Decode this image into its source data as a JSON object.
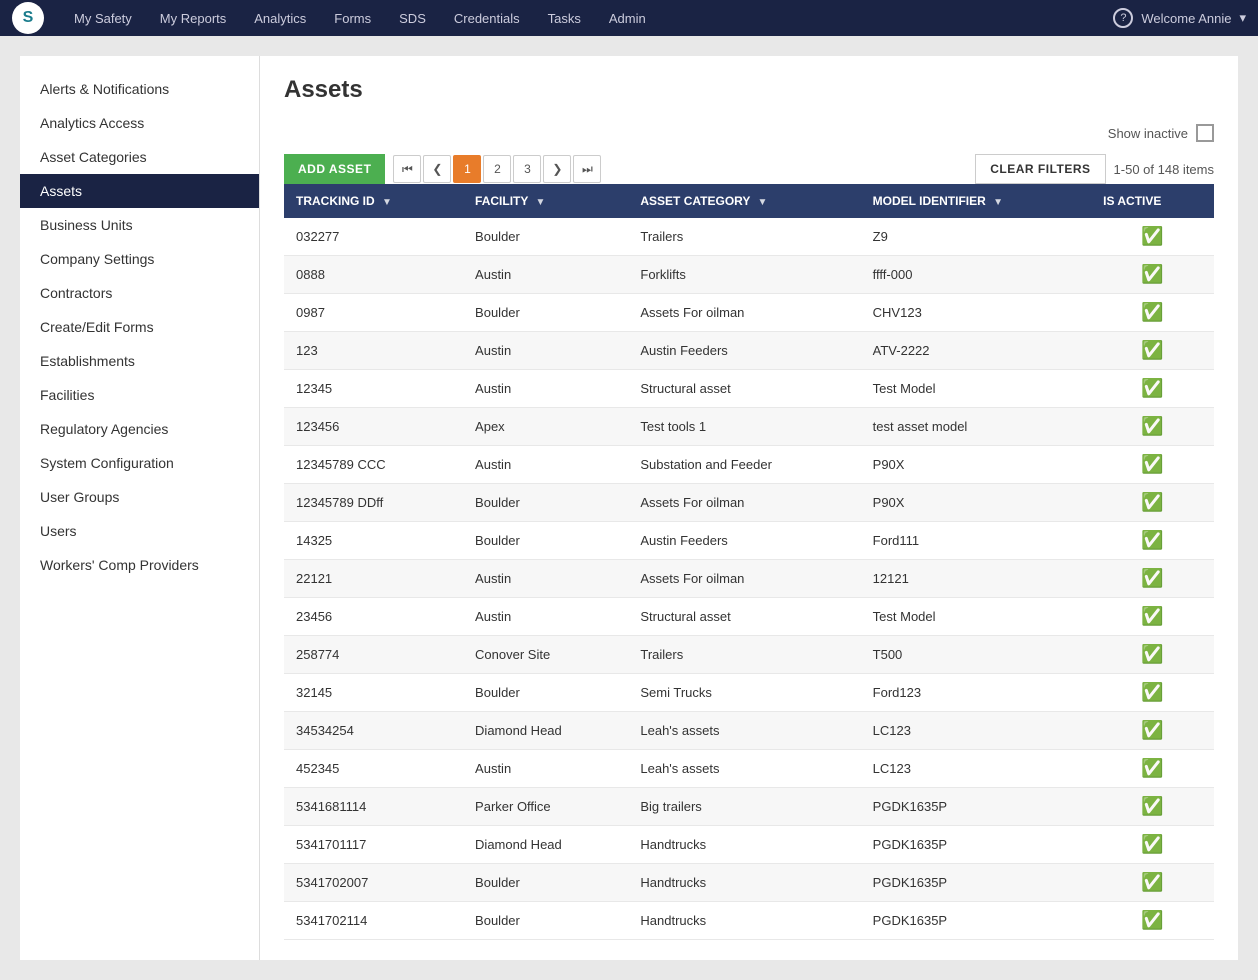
{
  "topNav": {
    "logo": "S",
    "links": [
      {
        "label": "My Safety",
        "name": "my-safety"
      },
      {
        "label": "My Reports",
        "name": "my-reports"
      },
      {
        "label": "Analytics",
        "name": "analytics"
      },
      {
        "label": "Forms",
        "name": "forms"
      },
      {
        "label": "SDS",
        "name": "sds"
      },
      {
        "label": "Credentials",
        "name": "credentials"
      },
      {
        "label": "Tasks",
        "name": "tasks"
      },
      {
        "label": "Admin",
        "name": "admin"
      }
    ],
    "welcome": "Welcome Annie",
    "help_icon": "?"
  },
  "sidebar": {
    "items": [
      {
        "label": "Alerts & Notifications",
        "name": "alerts-notifications",
        "active": false
      },
      {
        "label": "Analytics Access",
        "name": "analytics-access",
        "active": false
      },
      {
        "label": "Asset Categories",
        "name": "asset-categories",
        "active": false
      },
      {
        "label": "Assets",
        "name": "assets",
        "active": true
      },
      {
        "label": "Business Units",
        "name": "business-units",
        "active": false
      },
      {
        "label": "Company Settings",
        "name": "company-settings",
        "active": false
      },
      {
        "label": "Contractors",
        "name": "contractors",
        "active": false
      },
      {
        "label": "Create/Edit Forms",
        "name": "create-edit-forms",
        "active": false
      },
      {
        "label": "Establishments",
        "name": "establishments",
        "active": false
      },
      {
        "label": "Facilities",
        "name": "facilities",
        "active": false
      },
      {
        "label": "Regulatory Agencies",
        "name": "regulatory-agencies",
        "active": false
      },
      {
        "label": "System Configuration",
        "name": "system-configuration",
        "active": false
      },
      {
        "label": "User Groups",
        "name": "user-groups",
        "active": false
      },
      {
        "label": "Users",
        "name": "users",
        "active": false
      },
      {
        "label": "Workers' Comp Providers",
        "name": "workers-comp-providers",
        "active": false
      }
    ]
  },
  "content": {
    "page_title": "Assets",
    "show_inactive_label": "Show inactive",
    "add_asset_label": "ADD ASSET",
    "clear_filters_label": "CLEAR FILTERS",
    "items_count": "1-50 of 148 items",
    "pagination": {
      "pages": [
        "1",
        "2",
        "3"
      ],
      "active_page": "1"
    },
    "table": {
      "columns": [
        {
          "label": "TRACKING ID",
          "name": "tracking-id-col"
        },
        {
          "label": "FACILITY",
          "name": "facility-col"
        },
        {
          "label": "ASSET CATEGORY",
          "name": "asset-category-col"
        },
        {
          "label": "MODEL IDENTIFIER",
          "name": "model-identifier-col"
        },
        {
          "label": "IS ACTIVE",
          "name": "is-active-col"
        }
      ],
      "rows": [
        {
          "tracking_id": "032277",
          "facility": "Boulder",
          "asset_category": "Trailers",
          "model_identifier": "Z9",
          "is_active": true
        },
        {
          "tracking_id": "0888",
          "facility": "Austin",
          "asset_category": "Forklifts",
          "model_identifier": "ffff-000",
          "is_active": true
        },
        {
          "tracking_id": "0987",
          "facility": "Boulder",
          "asset_category": "Assets For oilman",
          "model_identifier": "CHV123",
          "is_active": true
        },
        {
          "tracking_id": "123",
          "facility": "Austin",
          "asset_category": "Austin Feeders",
          "model_identifier": "ATV-2222",
          "is_active": true
        },
        {
          "tracking_id": "12345",
          "facility": "Austin",
          "asset_category": "Structural asset",
          "model_identifier": "Test Model",
          "is_active": true
        },
        {
          "tracking_id": "123456",
          "facility": "Apex",
          "asset_category": "Test tools 1",
          "model_identifier": "test asset model",
          "is_active": true
        },
        {
          "tracking_id": "12345789 CCC",
          "facility": "Austin",
          "asset_category": "Substation and Feeder",
          "model_identifier": "P90X",
          "is_active": true
        },
        {
          "tracking_id": "12345789 DDff",
          "facility": "Boulder",
          "asset_category": "Assets For oilman",
          "model_identifier": "P90X",
          "is_active": true
        },
        {
          "tracking_id": "14325",
          "facility": "Boulder",
          "asset_category": "Austin Feeders",
          "model_identifier": "Ford111",
          "is_active": true
        },
        {
          "tracking_id": "22121",
          "facility": "Austin",
          "asset_category": "Assets For oilman",
          "model_identifier": "12121",
          "is_active": true
        },
        {
          "tracking_id": "23456",
          "facility": "Austin",
          "asset_category": "Structural asset",
          "model_identifier": "Test Model",
          "is_active": true
        },
        {
          "tracking_id": "258774",
          "facility": "Conover Site",
          "asset_category": "Trailers",
          "model_identifier": "T500",
          "is_active": true
        },
        {
          "tracking_id": "32145",
          "facility": "Boulder",
          "asset_category": "Semi Trucks",
          "model_identifier": "Ford123",
          "is_active": true
        },
        {
          "tracking_id": "34534254",
          "facility": "Diamond Head",
          "asset_category": "Leah's assets",
          "model_identifier": "LC123",
          "is_active": true
        },
        {
          "tracking_id": "452345",
          "facility": "Austin",
          "asset_category": "Leah's assets",
          "model_identifier": "LC123",
          "is_active": true
        },
        {
          "tracking_id": "5341681114",
          "facility": "Parker Office",
          "asset_category": "Big trailers",
          "model_identifier": "PGDK1635P",
          "is_active": true
        },
        {
          "tracking_id": "5341701117",
          "facility": "Diamond Head",
          "asset_category": "Handtrucks",
          "model_identifier": "PGDK1635P",
          "is_active": true
        },
        {
          "tracking_id": "5341702007",
          "facility": "Boulder",
          "asset_category": "Handtrucks",
          "model_identifier": "PGDK1635P",
          "is_active": true
        },
        {
          "tracking_id": "5341702114",
          "facility": "Boulder",
          "asset_category": "Handtrucks",
          "model_identifier": "PGDK1635P",
          "is_active": true
        }
      ]
    }
  }
}
